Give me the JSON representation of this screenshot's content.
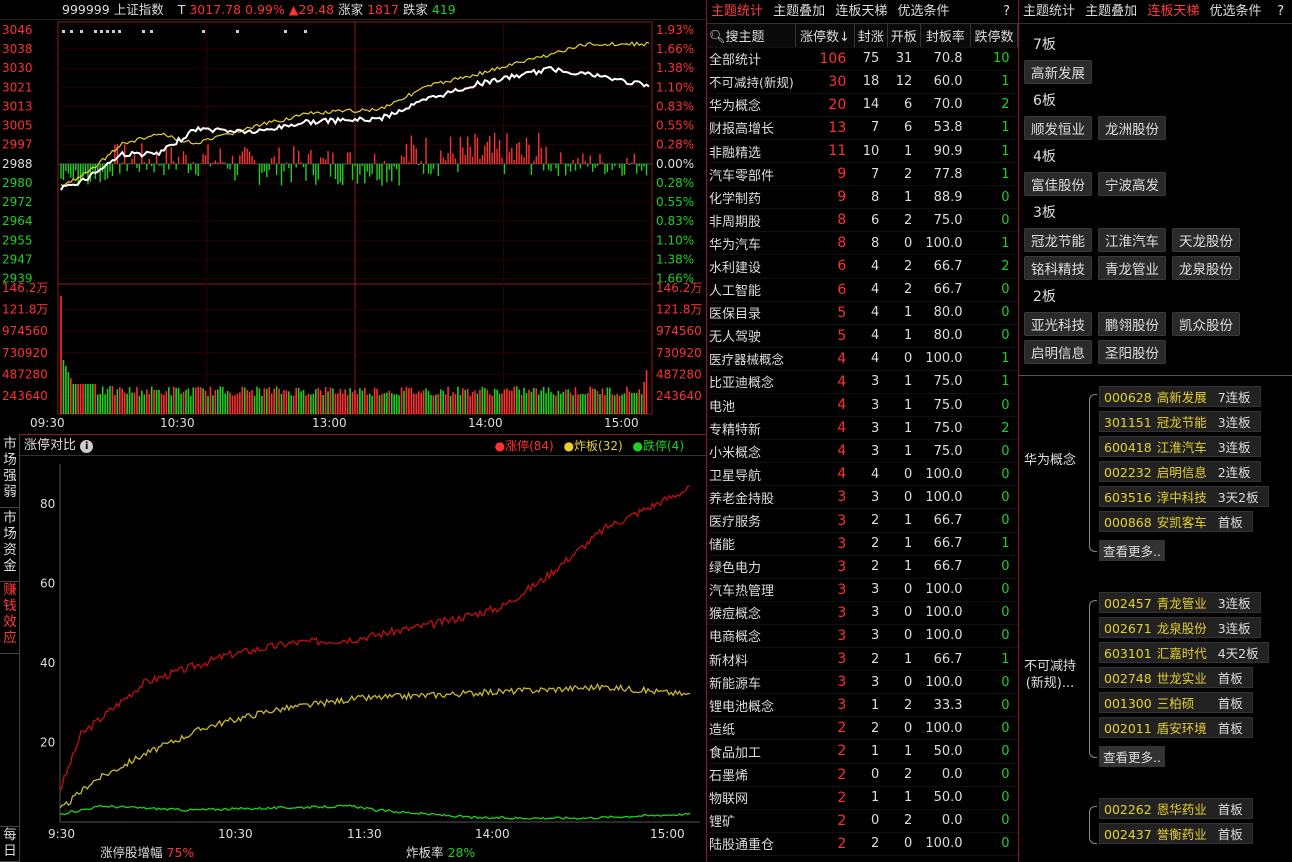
{
  "index_header": {
    "code": "999999",
    "name": "上证指数",
    "t_label": "T",
    "price": "3017.78",
    "pct": "0.99%",
    "change": "▲29.48",
    "up_label": "涨家",
    "up_count": "1817",
    "down_label": "跌家",
    "down_count": "419"
  },
  "price_axis_left": [
    "3046",
    "3038",
    "3030",
    "3021",
    "3013",
    "3005",
    "2997",
    "2988",
    "2980",
    "2972",
    "2964",
    "2955",
    "2947",
    "2939"
  ],
  "price_axis_right": [
    "1.93%",
    "1.66%",
    "1.38%",
    "1.10%",
    "0.83%",
    "0.55%",
    "0.28%",
    "0.00%",
    "0.28%",
    "0.55%",
    "0.83%",
    "1.10%",
    "1.38%",
    "1.66%"
  ],
  "vol_axis": [
    "146.2万",
    "121.8万",
    "974560",
    "730920",
    "487280",
    "243640"
  ],
  "time_axis": [
    "09:30",
    "10:30",
    "13:00",
    "14:00",
    "15:00"
  ],
  "vertical_tabs": [
    {
      "label": "市场强弱",
      "active": false
    },
    {
      "label": "市场资金",
      "active": false
    },
    {
      "label": "赚钱效应",
      "active": true
    },
    {
      "label": "每日",
      "active": false
    }
  ],
  "compare_chart": {
    "title": "涨停对比",
    "legend": [
      {
        "label": "涨停(84)",
        "color": "#ff3030"
      },
      {
        "label": "炸板(32)",
        "color": "#e6d030"
      },
      {
        "label": "跌停(4)",
        "color": "#1fd11f"
      }
    ],
    "y_ticks": [
      "80",
      "60",
      "40",
      "20"
    ],
    "x_ticks": [
      "9:30",
      "10:30",
      "11:30",
      "14:00",
      "15:00"
    ],
    "footer_left_label": "涨停股增幅",
    "footer_left_value": "75%",
    "footer_right_label": "炸板率",
    "footer_right_value": "28%"
  },
  "mid_tabs": [
    "主题统计",
    "主题叠加",
    "连板天梯",
    "优选条件"
  ],
  "mid_active": 0,
  "right_tabs": [
    "主题统计",
    "主题叠加",
    "连板天梯",
    "优选条件"
  ],
  "right_active": 2,
  "help": "?",
  "theme_table": {
    "search_label": "搜主题",
    "headers": [
      "涨停数↓",
      "封涨",
      "开板",
      "封板率",
      "跌停数"
    ],
    "rows": [
      [
        "全部统计",
        "106",
        "75",
        "31",
        "70.8",
        "10"
      ],
      [
        "不可减持(新规)",
        "30",
        "18",
        "12",
        "60.0",
        "1"
      ],
      [
        "华为概念",
        "20",
        "14",
        "6",
        "70.0",
        "2"
      ],
      [
        "财报高增长",
        "13",
        "7",
        "6",
        "53.8",
        "1"
      ],
      [
        "非融精选",
        "11",
        "10",
        "1",
        "90.9",
        "1"
      ],
      [
        "汽车零部件",
        "9",
        "7",
        "2",
        "77.8",
        "1"
      ],
      [
        "化学制药",
        "9",
        "8",
        "1",
        "88.9",
        "0"
      ],
      [
        "非周期股",
        "8",
        "6",
        "2",
        "75.0",
        "0"
      ],
      [
        "华为汽车",
        "8",
        "8",
        "0",
        "100.0",
        "1"
      ],
      [
        "水利建设",
        "6",
        "4",
        "2",
        "66.7",
        "2"
      ],
      [
        "人工智能",
        "6",
        "4",
        "2",
        "66.7",
        "0"
      ],
      [
        "医保目录",
        "5",
        "4",
        "1",
        "80.0",
        "0"
      ],
      [
        "无人驾驶",
        "5",
        "4",
        "1",
        "80.0",
        "0"
      ],
      [
        "医疗器械概念",
        "4",
        "4",
        "0",
        "100.0",
        "1"
      ],
      [
        "比亚迪概念",
        "4",
        "3",
        "1",
        "75.0",
        "1"
      ],
      [
        "电池",
        "4",
        "3",
        "1",
        "75.0",
        "0"
      ],
      [
        "专精特新",
        "4",
        "3",
        "1",
        "75.0",
        "2"
      ],
      [
        "小米概念",
        "4",
        "3",
        "1",
        "75.0",
        "0"
      ],
      [
        "卫星导航",
        "4",
        "4",
        "0",
        "100.0",
        "0"
      ],
      [
        "养老金持股",
        "3",
        "3",
        "0",
        "100.0",
        "0"
      ],
      [
        "医疗服务",
        "3",
        "2",
        "1",
        "66.7",
        "0"
      ],
      [
        "储能",
        "3",
        "2",
        "1",
        "66.7",
        "1"
      ],
      [
        "绿色电力",
        "3",
        "2",
        "1",
        "66.7",
        "0"
      ],
      [
        "汽车热管理",
        "3",
        "3",
        "0",
        "100.0",
        "0"
      ],
      [
        "猴痘概念",
        "3",
        "3",
        "0",
        "100.0",
        "0"
      ],
      [
        "电商概念",
        "3",
        "3",
        "0",
        "100.0",
        "0"
      ],
      [
        "新材料",
        "3",
        "2",
        "1",
        "66.7",
        "1"
      ],
      [
        "新能源车",
        "3",
        "3",
        "0",
        "100.0",
        "0"
      ],
      [
        "锂电池概念",
        "3",
        "1",
        "2",
        "33.3",
        "0"
      ],
      [
        "造纸",
        "2",
        "2",
        "0",
        "100.0",
        "0"
      ],
      [
        "食品加工",
        "2",
        "1",
        "1",
        "50.0",
        "0"
      ],
      [
        "石墨烯",
        "2",
        "0",
        "2",
        "0.0",
        "0"
      ],
      [
        "物联网",
        "2",
        "1",
        "1",
        "50.0",
        "0"
      ],
      [
        "锂矿",
        "2",
        "0",
        "2",
        "0.0",
        "0"
      ],
      [
        "陆股通重仓",
        "2",
        "2",
        "0",
        "100.0",
        "0"
      ]
    ]
  },
  "ladder": [
    {
      "level": "7板",
      "stocks": [
        "高新发展"
      ]
    },
    {
      "level": "6板",
      "stocks": [
        "顺发恒业",
        "龙洲股份"
      ]
    },
    {
      "level": "4板",
      "stocks": [
        "富佳股份",
        "宁波高发"
      ]
    },
    {
      "level": "3板",
      "stocks": [
        "冠龙节能",
        "江淮汽车",
        "天龙股份",
        "铭科精技",
        "青龙管业",
        "龙泉股份"
      ]
    },
    {
      "level": "2板",
      "stocks": [
        "亚光科技",
        "鹏翎股份",
        "凯众股份",
        "启明信息",
        "圣阳股份"
      ]
    }
  ],
  "theme_groups": [
    {
      "name": "华为概念",
      "stocks": [
        [
          "000628",
          "高新发展",
          "7连板"
        ],
        [
          "301151",
          "冠龙节能",
          "3连板"
        ],
        [
          "600418",
          "江淮汽车",
          "3连板"
        ],
        [
          "002232",
          "启明信息",
          "2连板"
        ],
        [
          "603516",
          "淳中科技",
          "3天2板"
        ],
        [
          "000868",
          "安凯客车",
          "首板"
        ]
      ],
      "more": "查看更多.."
    },
    {
      "name": "不可减持(新规)...",
      "stocks": [
        [
          "002457",
          "青龙管业",
          "3连板"
        ],
        [
          "002671",
          "龙泉股份",
          "3连板"
        ],
        [
          "603101",
          "汇嘉时代",
          "4天2板"
        ],
        [
          "002748",
          "世龙实业",
          "首板"
        ],
        [
          "001300",
          "三柏硕",
          "首板"
        ],
        [
          "002011",
          "盾安环境",
          "首板"
        ]
      ],
      "more": "查看更多.."
    },
    {
      "name": "",
      "stocks": [
        [
          "002262",
          "恩华药业",
          "首板"
        ],
        [
          "002437",
          "誉衡药业",
          "首板"
        ]
      ],
      "more": ""
    }
  ]
}
